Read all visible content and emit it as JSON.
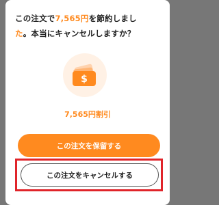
{
  "dialog": {
    "title_line1_part1": "この注文で",
    "title_amount": "7,565円",
    "title_line1_part2": "を節約しまし",
    "title_line2_accent": "た",
    "title_line2_rest": "。本当にキャンセルしますか？",
    "icon": "wallet-dollar-icon",
    "discount_label": "7,565円割引",
    "keep_button_label": "この注文を保留する",
    "cancel_button_label": "この注文をキャンセルする"
  },
  "colors": {
    "accent": "#ff8a1f",
    "icon_bg": "#fff1e5",
    "highlight_border": "#e0242a",
    "overlay": "#777777"
  }
}
